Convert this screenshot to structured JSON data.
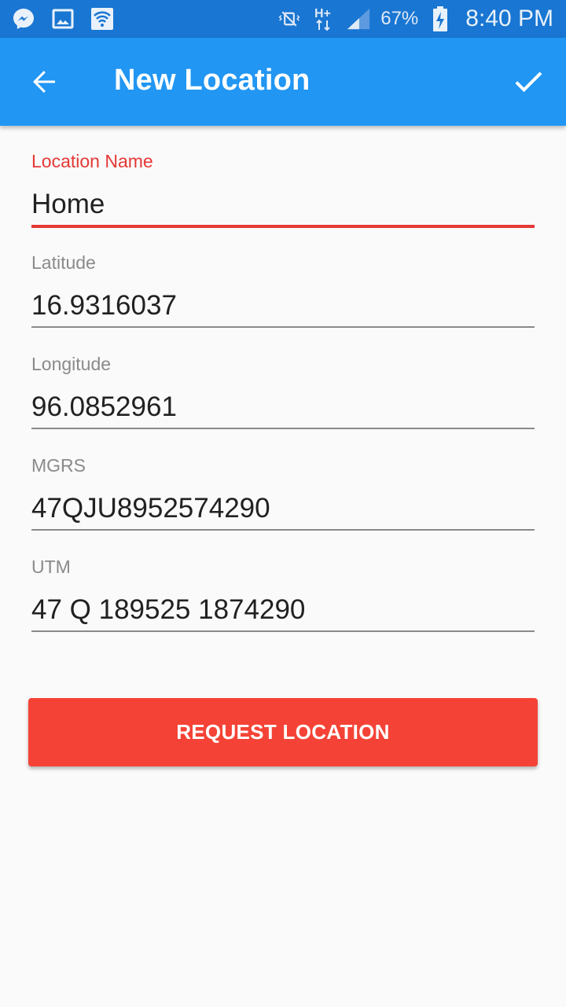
{
  "status_bar": {
    "icons_left": [
      "messenger-icon",
      "image-icon",
      "wifi-icon"
    ],
    "icons_right": [
      "vibrate-icon",
      "h-plus-data-icon",
      "signal-icon"
    ],
    "battery_percent": "67%",
    "time": "8:40 PM"
  },
  "app_bar": {
    "title": "New Location",
    "back_icon": "arrow-back-icon",
    "confirm_icon": "check-icon"
  },
  "form": {
    "location_name": {
      "label": "Location Name",
      "value": "Home"
    },
    "latitude": {
      "label": "Latitude",
      "value": "16.9316037"
    },
    "longitude": {
      "label": "Longitude",
      "value": "96.0852961"
    },
    "mgrs": {
      "label": "MGRS",
      "value": "47QJU8952574290"
    },
    "utm": {
      "label": "UTM",
      "value": "47 Q 189525 1874290"
    }
  },
  "request_button": {
    "label": "REQUEST LOCATION"
  },
  "colors": {
    "status_bar": "#1976d2",
    "app_bar": "#2196f3",
    "accent": "#f44336",
    "active_field": "#e53935",
    "background": "#fafafa"
  }
}
